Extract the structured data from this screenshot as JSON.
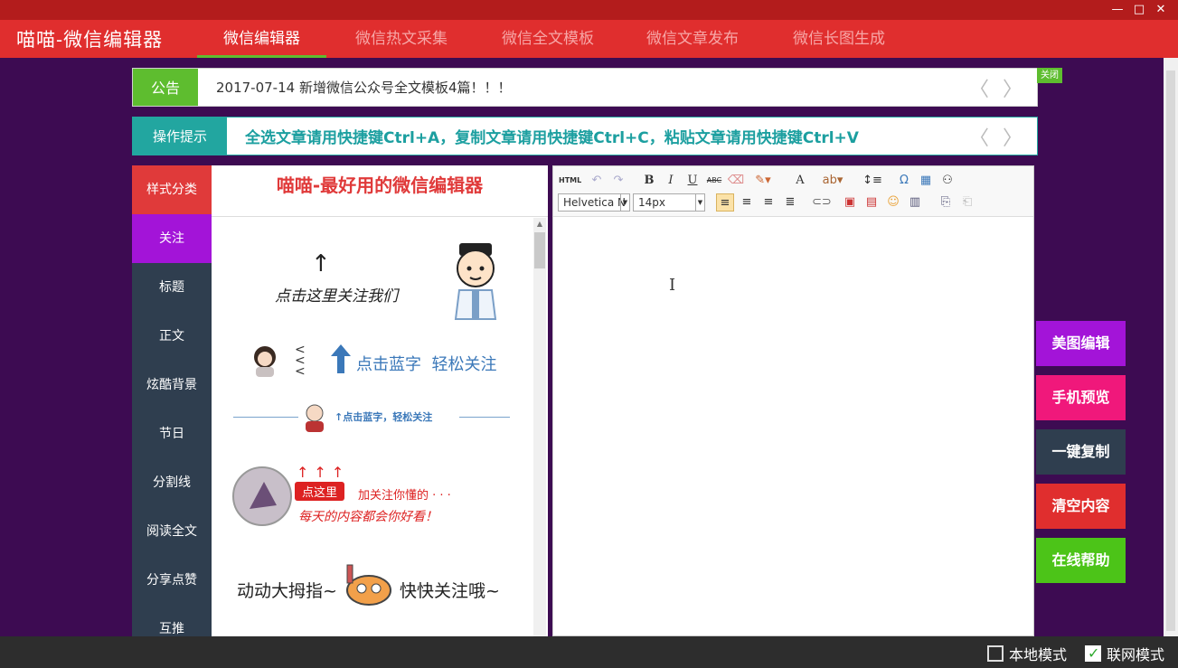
{
  "app": {
    "title": "喵喵-微信编辑器",
    "window_controls": [
      "—",
      "□",
      "✕"
    ]
  },
  "nav": {
    "tabs": [
      {
        "label": "微信编辑器",
        "active": true
      },
      {
        "label": "微信热文采集",
        "active": false
      },
      {
        "label": "微信全文模板",
        "active": false
      },
      {
        "label": "微信文章发布",
        "active": false
      },
      {
        "label": "微信长图生成",
        "active": false
      }
    ]
  },
  "notice": {
    "label": "公告",
    "text": "2017-07-14 新增微信公众号全文模板4篇！！！",
    "close_label": "关闭",
    "arrows": "〈 〉"
  },
  "tip": {
    "label": "操作提示",
    "text": "全选文章请用快捷键Ctrl+A，复制文章请用快捷键Ctrl+C，粘贴文章请用快捷键Ctrl+V",
    "arrows": "〈 〉"
  },
  "categories": {
    "items": [
      "样式分类",
      "关注",
      "标题",
      "正文",
      "炫酷背景",
      "节日",
      "分割线",
      "阅读全文",
      "分享点赞",
      "互推"
    ]
  },
  "styles": {
    "title": "喵喵-最好用的微信编辑器",
    "samples": {
      "s1_text": "点击这里关注我们",
      "s2_text": "点击蓝字  轻松关注",
      "s3_text": "↑点击蓝字，轻松关注",
      "s4_tag": "点这里",
      "s4_line1": "加关注你懂的 · · ·",
      "s4_line2": "每天的内容都会你好看！",
      "s5_text1": "动动大拇指~",
      "s5_text2": "快快关注哦~"
    }
  },
  "editor": {
    "toolbar": {
      "html": "HTML",
      "bold": "B",
      "italic": "I",
      "underline": "U",
      "strike": "ABC",
      "font_color": "A",
      "omega": "Ω",
      "font_family": "Helvetica N",
      "font_size": "14px"
    },
    "cursor": "I"
  },
  "actions": [
    {
      "label": "美图编辑",
      "color": "#a314d8"
    },
    {
      "label": "手机预览",
      "color": "#f0187b"
    },
    {
      "label": "一键复制",
      "color": "#2f3e4f"
    },
    {
      "label": "清空内容",
      "color": "#e02e2e"
    },
    {
      "label": "在线帮助",
      "color": "#4cc418"
    }
  ],
  "footer": {
    "local_mode": "本地模式",
    "online_mode": "联网模式"
  },
  "colors": {
    "title_red": "#e02e2e",
    "accent_green": "#5ebd2f",
    "accent_teal": "#22a6a0",
    "panel_dark": "#2f3e4f",
    "background_purple": "#3d0b52",
    "category_active": "#a314d8",
    "category_first": "#e03a3a"
  }
}
